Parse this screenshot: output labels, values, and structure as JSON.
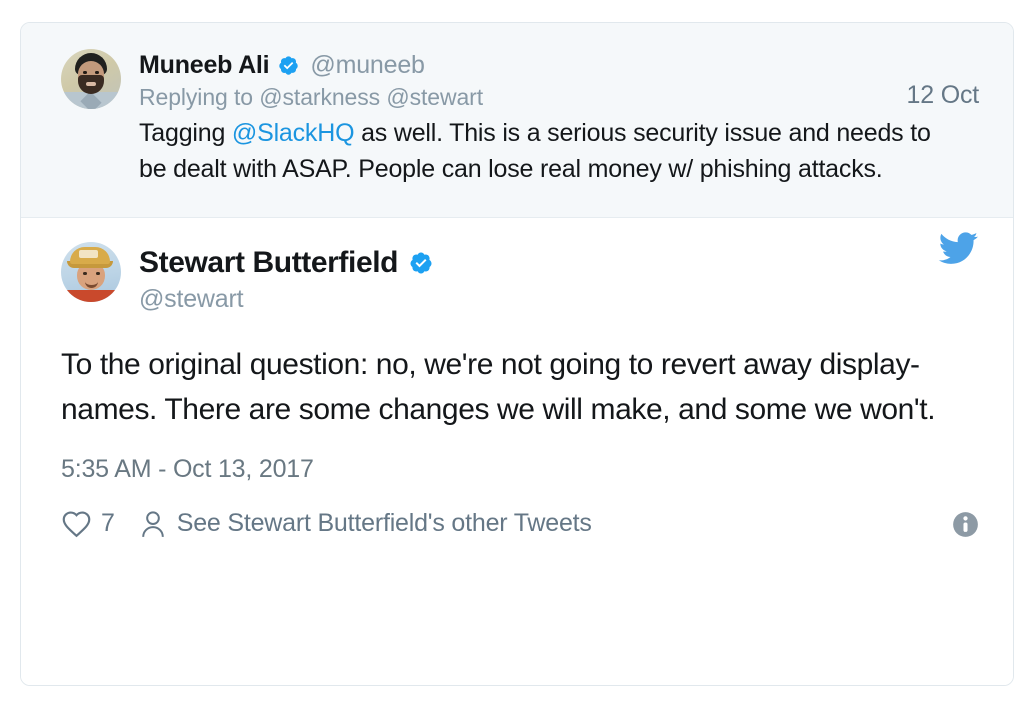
{
  "card": {
    "accent_color": "#1b95e0",
    "verified_color": "#1da1f2",
    "parent_bg": "#f5f8fa",
    "main_bg": "#ffffff",
    "border_color": "#e1e8ed",
    "text_color": "#14171a",
    "muted_color": "#8899a6"
  },
  "parent_tweet": {
    "avatar_name": "muneeb-ali-avatar",
    "display_name": "Muneeb Ali",
    "verified": true,
    "verified_icon": "verified-badge-icon",
    "handle": "@muneeb",
    "date": "12 Oct",
    "replying_to": "Replying to @starkness @stewart",
    "body_before_link": "Tagging ",
    "body_link": "@SlackHQ",
    "body_after_link": " as well. This is a serious security issue and needs to be dealt with ASAP. People can lose real money w/ phishing attacks."
  },
  "main_tweet": {
    "avatar_name": "stewart-butterfield-avatar",
    "display_name": "Stewart Butterfield",
    "verified": true,
    "verified_icon": "verified-badge-icon",
    "handle": "@stewart",
    "brand_icon": "twitter-bird-icon",
    "body": "To the original question: no, we're not going to revert away display-names. There are some changes we will make, and some we won't.",
    "timestamp": "5:35 AM - Oct 13, 2017",
    "footer": {
      "like_icon": "heart-icon",
      "like_count": "7",
      "profile_icon": "person-icon",
      "other_tweets_label": "See Stewart Butterfield's other Tweets",
      "info_icon": "info-icon"
    }
  }
}
